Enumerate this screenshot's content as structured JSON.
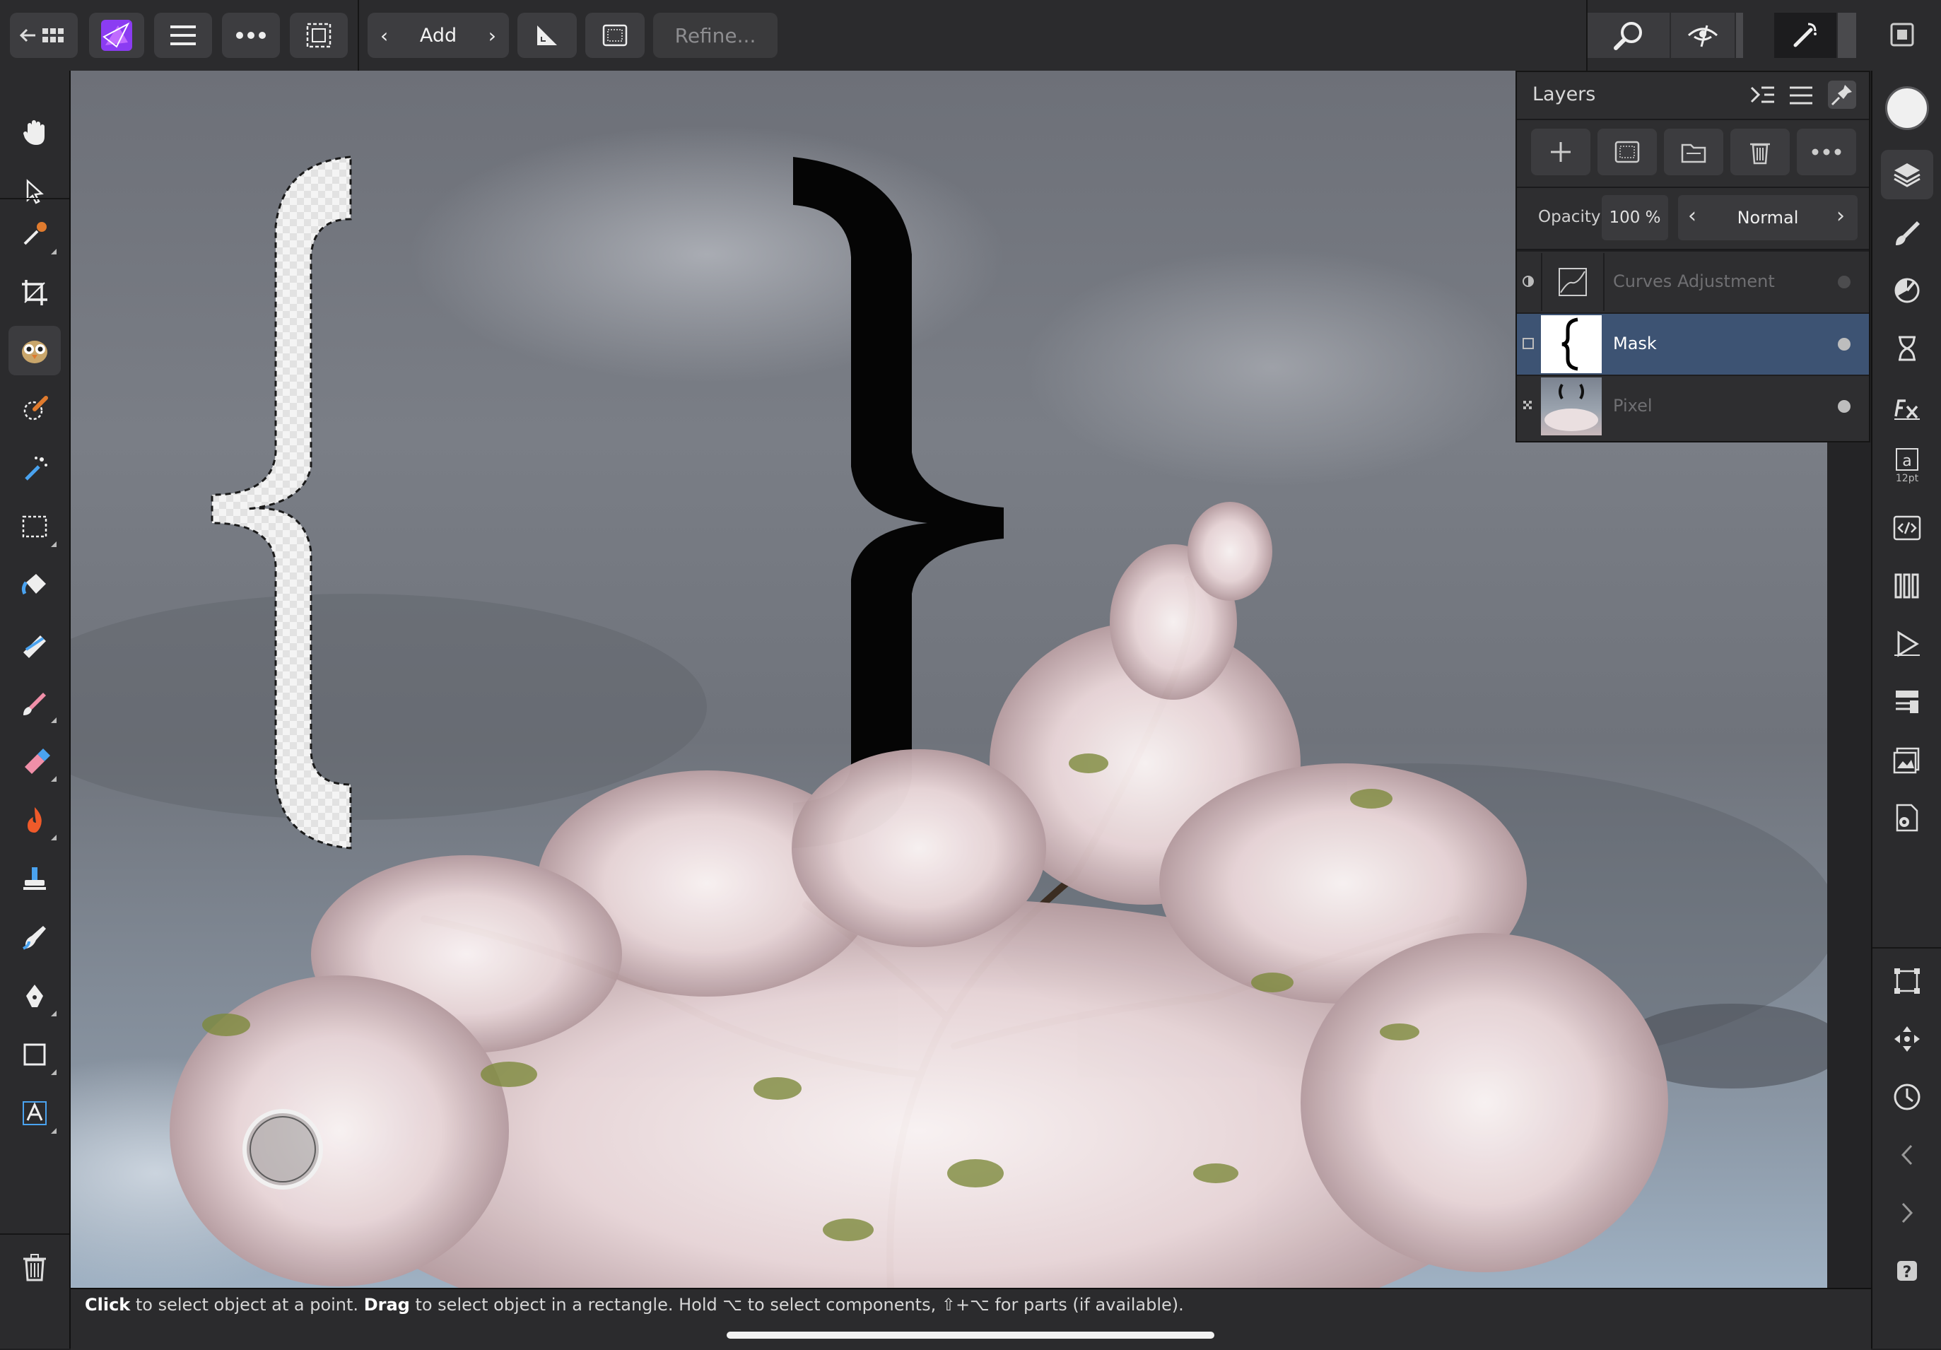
{
  "topbar": {
    "mode_label": "Add",
    "refine_label": "Refine..."
  },
  "layers_panel": {
    "title": "Layers",
    "opacity_label": "Opacity",
    "opacity_value": "100 %",
    "blend_mode": "Normal",
    "layers": [
      {
        "name": "Curves Adjustment",
        "type": "adjustment",
        "selected": false,
        "visible": false
      },
      {
        "name": "Mask",
        "type": "mask",
        "selected": true,
        "visible": true
      },
      {
        "name": "Pixel",
        "type": "pixel",
        "selected": false,
        "visible": true
      }
    ]
  },
  "statusbar": {
    "click_word": "Click",
    "click_rest": " to select object at a point. ",
    "drag_word": "Drag",
    "drag_rest": " to select object in a rectangle. Hold ⌥ to select components, ⇧+⌥ for parts (if available)."
  },
  "right_toolbar": {
    "text_style_size": "12pt"
  },
  "colors": {
    "accent_selected_layer": "#3d5373",
    "app_icon": "#8b3cf2",
    "ui_background": "#2b2b2d"
  }
}
